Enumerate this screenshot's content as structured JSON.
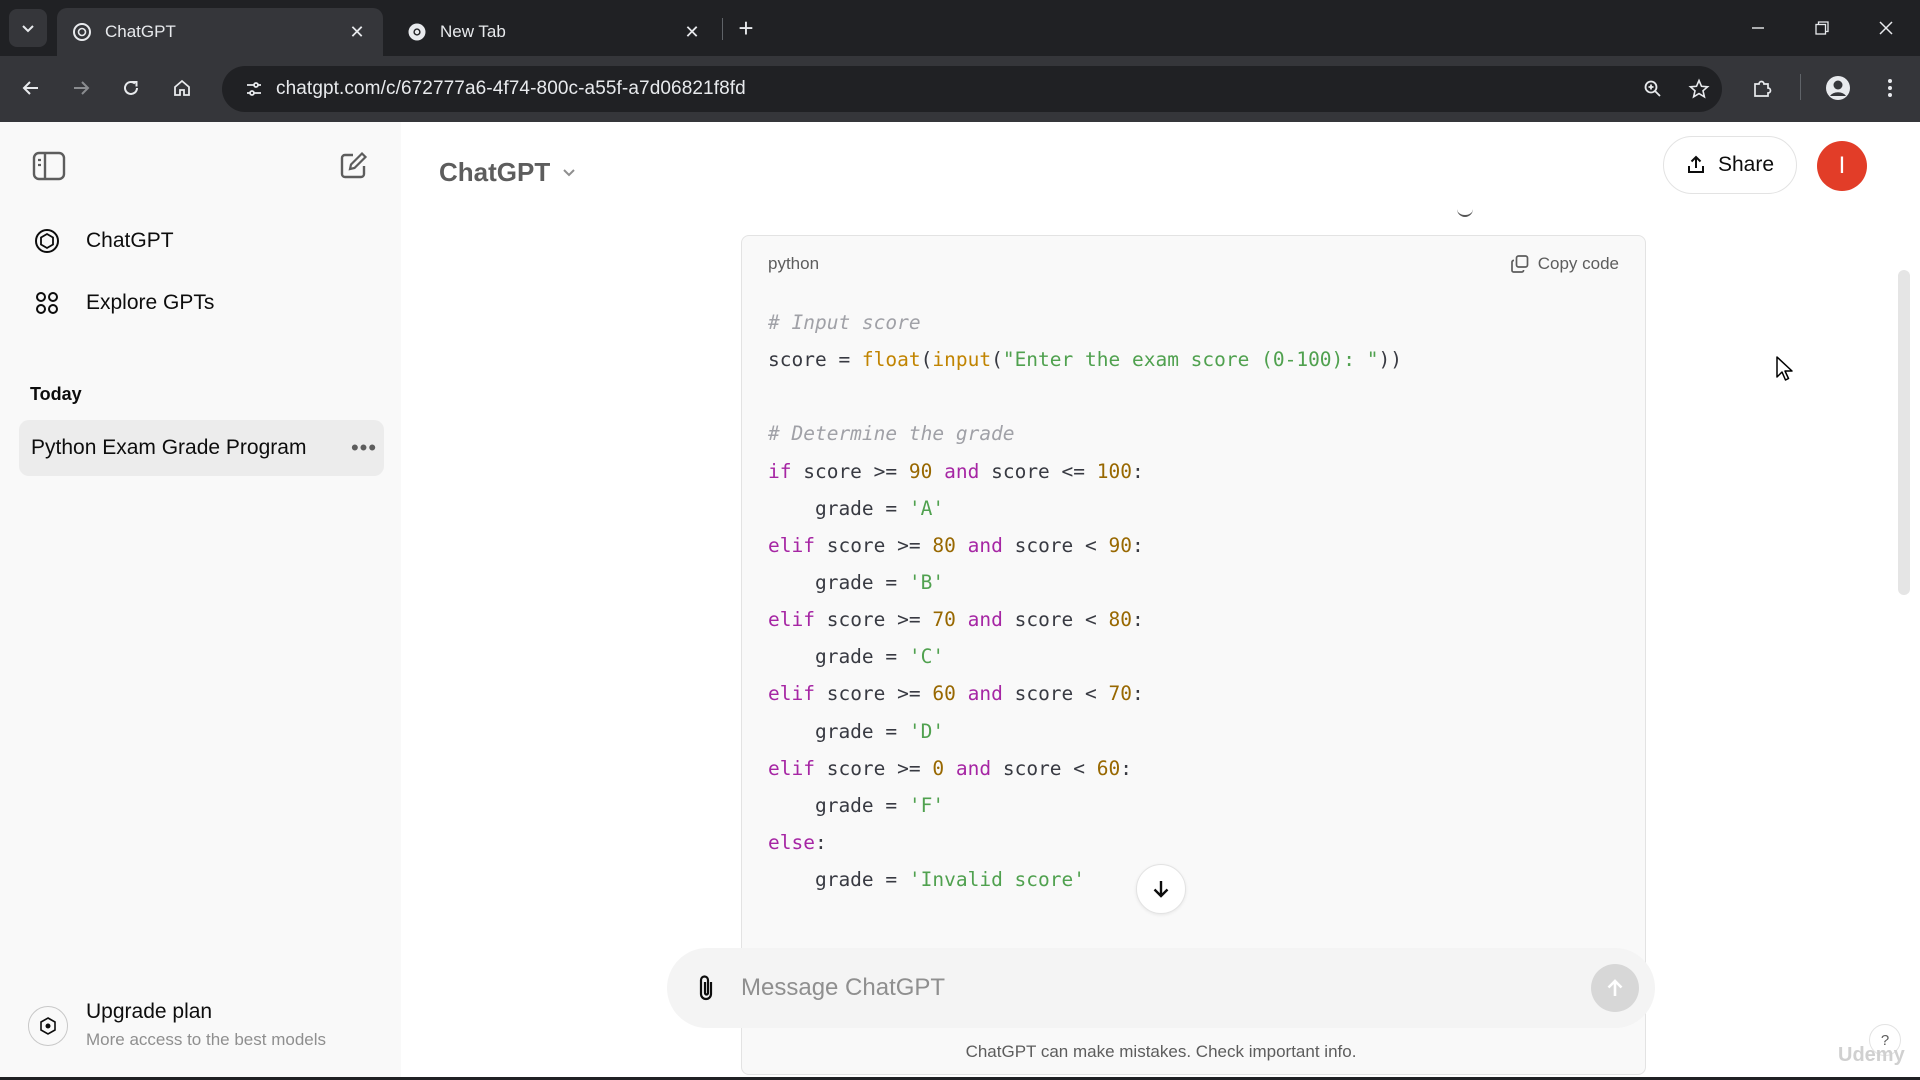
{
  "browser": {
    "tabs": [
      {
        "title": "ChatGPT",
        "active": true,
        "icon": "openai-logo-icon"
      },
      {
        "title": "New Tab",
        "active": false,
        "icon": "chrome-icon"
      }
    ],
    "url": "chatgpt.com/c/672777a6-4f74-800c-a55f-a7d06821f8fd",
    "toolbar_icons": [
      "back-icon",
      "forward-icon",
      "reload-icon",
      "home-icon",
      "site-settings-icon",
      "zoom-icon",
      "bookmark-star-icon",
      "extensions-icon",
      "profile-icon",
      "menu-icon"
    ]
  },
  "sidebar": {
    "nav": [
      {
        "label": "ChatGPT",
        "icon": "openai-logo-icon"
      },
      {
        "label": "Explore GPTs",
        "icon": "grid-icon"
      }
    ],
    "section_title": "Today",
    "chats": [
      {
        "label": "Python Exam Grade Program"
      }
    ],
    "upgrade": {
      "title": "Upgrade plan",
      "subtitle": "More access to the best models"
    }
  },
  "header": {
    "model": "ChatGPT",
    "share_label": "Share",
    "avatar_initial": "I",
    "avatar_color": "#e23d28"
  },
  "code_block": {
    "language": "python",
    "copy_label": "Copy code",
    "lines": [
      [
        {
          "t": "# Input score",
          "c": "com"
        }
      ],
      [
        {
          "t": "score = ",
          "c": "op"
        },
        {
          "t": "float",
          "c": "fn"
        },
        {
          "t": "(",
          "c": "op"
        },
        {
          "t": "input",
          "c": "fn"
        },
        {
          "t": "(",
          "c": "op"
        },
        {
          "t": "\"Enter the exam score (0-100): \"",
          "c": "str"
        },
        {
          "t": "))",
          "c": "op"
        }
      ],
      [
        {
          "t": "",
          "c": "op"
        }
      ],
      [
        {
          "t": "# Determine the grade",
          "c": "com"
        }
      ],
      [
        {
          "t": "if",
          "c": "kw"
        },
        {
          "t": " score >= ",
          "c": "op"
        },
        {
          "t": "90",
          "c": "num"
        },
        {
          "t": " ",
          "c": "op"
        },
        {
          "t": "and",
          "c": "kw"
        },
        {
          "t": " score <= ",
          "c": "op"
        },
        {
          "t": "100",
          "c": "num"
        },
        {
          "t": ":",
          "c": "op"
        }
      ],
      [
        {
          "t": "    grade = ",
          "c": "op"
        },
        {
          "t": "'A'",
          "c": "str"
        }
      ],
      [
        {
          "t": "elif",
          "c": "kw"
        },
        {
          "t": " score >= ",
          "c": "op"
        },
        {
          "t": "80",
          "c": "num"
        },
        {
          "t": " ",
          "c": "op"
        },
        {
          "t": "and",
          "c": "kw"
        },
        {
          "t": " score < ",
          "c": "op"
        },
        {
          "t": "90",
          "c": "num"
        },
        {
          "t": ":",
          "c": "op"
        }
      ],
      [
        {
          "t": "    grade = ",
          "c": "op"
        },
        {
          "t": "'B'",
          "c": "str"
        }
      ],
      [
        {
          "t": "elif",
          "c": "kw"
        },
        {
          "t": " score >= ",
          "c": "op"
        },
        {
          "t": "70",
          "c": "num"
        },
        {
          "t": " ",
          "c": "op"
        },
        {
          "t": "and",
          "c": "kw"
        },
        {
          "t": " score < ",
          "c": "op"
        },
        {
          "t": "80",
          "c": "num"
        },
        {
          "t": ":",
          "c": "op"
        }
      ],
      [
        {
          "t": "    grade = ",
          "c": "op"
        },
        {
          "t": "'C'",
          "c": "str"
        }
      ],
      [
        {
          "t": "elif",
          "c": "kw"
        },
        {
          "t": " score >= ",
          "c": "op"
        },
        {
          "t": "60",
          "c": "num"
        },
        {
          "t": " ",
          "c": "op"
        },
        {
          "t": "and",
          "c": "kw"
        },
        {
          "t": " score < ",
          "c": "op"
        },
        {
          "t": "70",
          "c": "num"
        },
        {
          "t": ":",
          "c": "op"
        }
      ],
      [
        {
          "t": "    grade = ",
          "c": "op"
        },
        {
          "t": "'D'",
          "c": "str"
        }
      ],
      [
        {
          "t": "elif",
          "c": "kw"
        },
        {
          "t": " score >= ",
          "c": "op"
        },
        {
          "t": "0",
          "c": "num"
        },
        {
          "t": " ",
          "c": "op"
        },
        {
          "t": "and",
          "c": "kw"
        },
        {
          "t": " score < ",
          "c": "op"
        },
        {
          "t": "60",
          "c": "num"
        },
        {
          "t": ":",
          "c": "op"
        }
      ],
      [
        {
          "t": "    grade = ",
          "c": "op"
        },
        {
          "t": "'F'",
          "c": "str"
        }
      ],
      [
        {
          "t": "else",
          "c": "kw"
        },
        {
          "t": ":",
          "c": "op"
        }
      ],
      [
        {
          "t": "    grade = ",
          "c": "op"
        },
        {
          "t": "'Invalid score'",
          "c": "str"
        }
      ]
    ]
  },
  "composer": {
    "placeholder": "Message ChatGPT",
    "value": ""
  },
  "footer_note": "ChatGPT can make mistakes. Check important info.",
  "help_label": "?",
  "watermark": "Udemy"
}
